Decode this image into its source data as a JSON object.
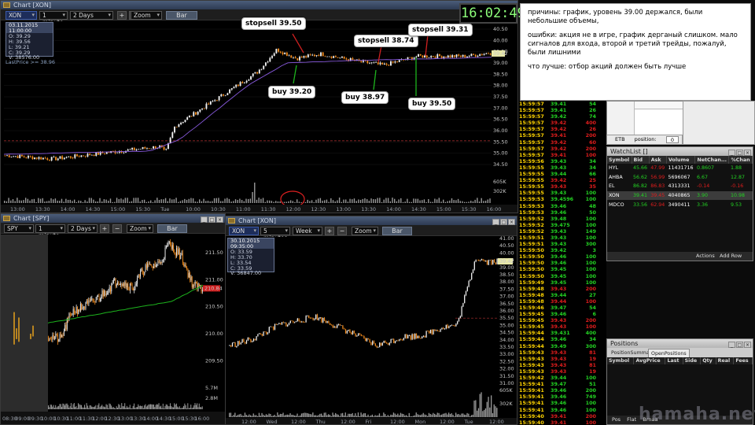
{
  "clock": "16:02:49",
  "notes": {
    "line1": "причины: график, уровень 39.00 держался, были небольшие объемы,",
    "line2": "ошибки: акция не в игре, график дерганый слишком. мало сигналов для входа, второй и третий трейды, пожалуй, были лишними",
    "line3": "что лучше: отбор акций должен быть лучше"
  },
  "chart_main": {
    "title": "Chart [XON]",
    "symbol": "XON",
    "interval": "1 minute",
    "range": "2 Days",
    "zoom": "Zoom",
    "bar": "Bar",
    "plus": "+",
    "minus": "−",
    "info": {
      "date": "03.11.2015 11:00:00",
      "o": "O: 39.29",
      "h": "H: 39.56",
      "l": "L: 39.21",
      "c": "C: 39.29",
      "v": "V: 38576.00"
    },
    "lastprice": "LastPrice >= 38.96",
    "yticks": [
      "40.50",
      "40.00",
      "39.50",
      "39.00",
      "38.50",
      "38.00",
      "37.50",
      "37.00",
      "36.50",
      "36.00",
      "35.50",
      "35.00",
      "34.50"
    ],
    "price_tag": "39.42",
    "vol_ticks": [
      "605K",
      "302K"
    ],
    "xticks": [
      "13:00",
      "13:30",
      "14:00",
      "14:30",
      "15:00",
      "15:30",
      "Tue",
      "10:00",
      "10:30",
      "11:00",
      "11:30",
      "12:00",
      "12:30",
      "13:00",
      "13:30",
      "14:00",
      "14:30",
      "15:00",
      "15:30",
      "16:00"
    ],
    "annotations": [
      {
        "text": "stopsell 39.50",
        "color": "#d02020"
      },
      {
        "text": "stopsell 38.74",
        "color": "#d02020"
      },
      {
        "text": "stopsell 39.31",
        "color": "#d02020"
      },
      {
        "text": "buy 39.20",
        "color": "#1db41d"
      },
      {
        "text": "buy 38.97",
        "color": "#1db41d"
      },
      {
        "text": "buy 39.50",
        "color": "#1db41d"
      }
    ]
  },
  "chart_spy": {
    "title": "Chart [SPY]",
    "symbol": "SPY",
    "interval": "1 minute",
    "range": "2 Days",
    "zoom": "Zoom",
    "bar": "Bar",
    "plus": "+",
    "minus": "−",
    "yticks": [
      "211.50",
      "211.00",
      "210.50",
      "210.00",
      "209.50"
    ],
    "price_tag": "210.84",
    "vol_ticks": [
      "5.7M",
      "2.8M"
    ],
    "xticks": [
      "08:30",
      "09:00",
      "09:30",
      "10:00",
      "10:30",
      "11:00",
      "11:30",
      "12:00",
      "12:30",
      "13:00",
      "13:30",
      "14:00",
      "14:30",
      "15:00",
      "15:30",
      "16:00"
    ]
  },
  "chart_week": {
    "title": "Chart [XON]",
    "symbol": "XON",
    "interval": "5 minutes",
    "range": "Week",
    "zoom": "Zoom",
    "bar": "Bar",
    "plus": "+",
    "minus": "−",
    "info": {
      "date": "30.10.2015 09:35:00",
      "o": "O: 33.59",
      "h": "H: 33.70",
      "l": "L: 33.54",
      "c": "C: 33.59",
      "v": "V: 36847.00"
    },
    "yticks": [
      "41.00",
      "40.50",
      "40.00",
      "39.50",
      "39.00",
      "38.50",
      "38.00",
      "37.50",
      "37.00",
      "36.50",
      "36.00",
      "35.50",
      "35.00",
      "34.50",
      "34.00",
      "33.50",
      "33.00",
      "32.50",
      "32.00",
      "31.50",
      "31.00"
    ],
    "price_tag": "39.42",
    "vol_ticks": [
      "605K",
      "302K"
    ],
    "xticks": [
      "12:00",
      "Wed",
      "12:00",
      "Thu",
      "12:00",
      "Fri",
      "12:00",
      "Mon",
      "12:00",
      "Tue",
      "12:00"
    ]
  },
  "time_sales": [
    [
      "15:59:57",
      "39.41",
      "54",
      "g"
    ],
    [
      "15:59:57",
      "39.41",
      "26",
      "g"
    ],
    [
      "15:59:57",
      "39.42",
      "74",
      "g"
    ],
    [
      "15:59:57",
      "39.42",
      "400",
      "r"
    ],
    [
      "15:59:57",
      "39.42",
      "26",
      "r"
    ],
    [
      "15:59:57",
      "39.41",
      "200",
      "r"
    ],
    [
      "15:59:57",
      "39.42",
      "60",
      "r"
    ],
    [
      "15:59:57",
      "39.42",
      "200",
      "r"
    ],
    [
      "15:59:57",
      "39.41",
      "100",
      "r"
    ],
    [
      "15:59:56",
      "39.43",
      "34",
      "g"
    ],
    [
      "15:59:55",
      "39.43",
      "34",
      "g"
    ],
    [
      "15:59:55",
      "39.44",
      "66",
      "g"
    ],
    [
      "15:59:55",
      "39.42",
      "25",
      "r"
    ],
    [
      "15:59:55",
      "39.43",
      "35",
      "r"
    ],
    [
      "15:59:55",
      "39.43",
      "100",
      "g"
    ],
    [
      "15:59:53",
      "39.4596",
      "100",
      "g"
    ],
    [
      "15:59:53",
      "39.46",
      "48",
      "g"
    ],
    [
      "15:59:53",
      "39.46",
      "50",
      "g"
    ],
    [
      "15:59:52",
      "39.48",
      "100",
      "g"
    ],
    [
      "15:59:52",
      "39.475",
      "100",
      "g"
    ],
    [
      "15:59:52",
      "39.43",
      "149",
      "g"
    ],
    [
      "15:59:51",
      "39.43",
      "100",
      "g"
    ],
    [
      "15:59:51",
      "39.43",
      "300",
      "g"
    ],
    [
      "15:59:50",
      "39.42",
      "3",
      "g"
    ],
    [
      "15:59:50",
      "39.46",
      "100",
      "g"
    ],
    [
      "15:59:50",
      "39.46",
      "100",
      "g"
    ],
    [
      "15:59:50",
      "39.45",
      "100",
      "g"
    ],
    [
      "15:59:50",
      "39.45",
      "100",
      "g"
    ],
    [
      "15:59:49",
      "39.45",
      "100",
      "g"
    ],
    [
      "15:59:48",
      "39.43",
      "200",
      "r"
    ],
    [
      "15:59:48",
      "39.44",
      "27",
      "g"
    ],
    [
      "15:59:48",
      "39.44",
      "100",
      "r"
    ],
    [
      "15:59:46",
      "39.47",
      "54",
      "g"
    ],
    [
      "15:59:45",
      "39.46",
      "6",
      "g"
    ],
    [
      "15:59:45",
      "39.43",
      "200",
      "r"
    ],
    [
      "15:59:45",
      "39.43",
      "100",
      "r"
    ],
    [
      "15:59:44",
      "39.431",
      "400",
      "g"
    ],
    [
      "15:59:44",
      "39.46",
      "34",
      "g"
    ],
    [
      "15:59:44",
      "39.49",
      "300",
      "g"
    ],
    [
      "15:59:43",
      "39.43",
      "81",
      "r"
    ],
    [
      "15:59:43",
      "39.43",
      "19",
      "r"
    ],
    [
      "15:59:43",
      "39.43",
      "81",
      "r"
    ],
    [
      "15:59:43",
      "39.43",
      "19",
      "r"
    ],
    [
      "15:59:42",
      "39.44",
      "100",
      "g"
    ],
    [
      "15:59:41",
      "39.47",
      "51",
      "g"
    ],
    [
      "15:59:41",
      "39.46",
      "200",
      "g"
    ],
    [
      "15:59:41",
      "39.46",
      "749",
      "g"
    ],
    [
      "15:59:41",
      "39.46",
      "100",
      "g"
    ],
    [
      "15:59:41",
      "39.46",
      "100",
      "g"
    ],
    [
      "15:59:40",
      "39.41",
      "200",
      "r"
    ],
    [
      "15:59:40",
      "39.41",
      "100",
      "r"
    ]
  ],
  "etb": {
    "label": "ETB",
    "position_label": "position:",
    "position_value": "0"
  },
  "watchlist": {
    "title": "WatchList []",
    "columns": [
      "Symbol",
      "Bid",
      "Ask",
      "Volume",
      "NetChan...",
      "%Chan"
    ],
    "rows": [
      {
        "symbol": "HYL",
        "bid": "45.66",
        "ask": "47.99",
        "volume": "11431716",
        "net": "0.8607",
        "pct": "1.88",
        "netColor": "#23d323"
      },
      {
        "symbol": "AHBA",
        "bid": "56.62",
        "ask": "56.99",
        "volume": "5696067",
        "net": "6.67",
        "pct": "12.87",
        "netColor": "#23d323"
      },
      {
        "symbol": "EL",
        "bid": "86.82",
        "ask": "86.83",
        "volume": "4313331",
        "net": "-0.14",
        "pct": "-0.16",
        "netColor": "#e01d1d"
      },
      {
        "symbol": "XON",
        "bid": "39.41",
        "ask": "39.45",
        "volume": "4040865",
        "net": "3.90",
        "pct": "10.98",
        "netColor": "#23d323"
      },
      {
        "symbol": "MDCO",
        "bid": "33.56",
        "ask": "62.94",
        "volume": "3490411",
        "net": "3.36",
        "pct": "9.53",
        "netColor": "#23d323"
      }
    ],
    "actions": "Actions",
    "add_row": "Add Row"
  },
  "positions": {
    "title": "Positions",
    "tabs": [
      "PositionSummary",
      "OpenPositions"
    ],
    "columns": [
      "Symbol",
      "AvgPrice",
      "Last",
      "Side",
      "Qty",
      "Real",
      "Fees"
    ],
    "footer": [
      "Pos",
      "Flat",
      "Brnaa"
    ]
  },
  "watermark": "hamaha.net"
}
